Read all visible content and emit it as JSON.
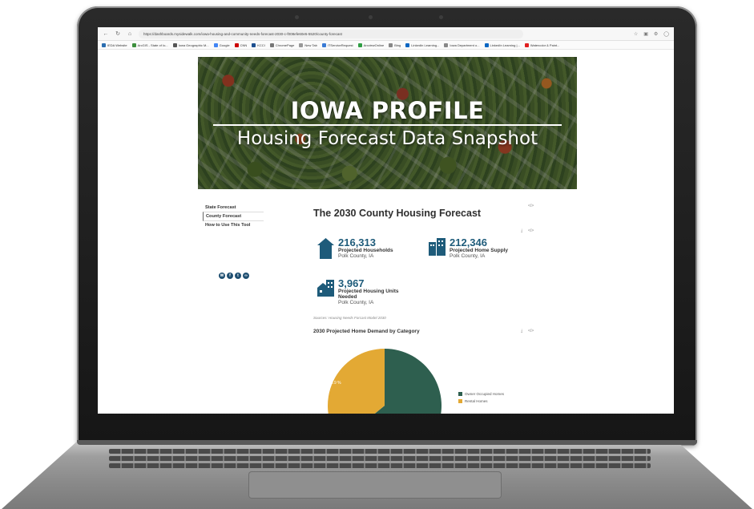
{
  "browser": {
    "url": "https://dashboards.mysidewalk.com/iowa-housing-and-community-needs-forecast-2030-c-f008efe60e5-5520/county-forecast",
    "bookmarks": [
      "IEDA Website",
      "ArcGIS - State of Io...",
      "Iowa Geographic M...",
      "Google",
      "CNN",
      "KCCI",
      "ChromePage",
      "New Tab",
      "ITServiceRequest",
      "ArcviewOnline",
      "Bing",
      "LinkedIn Learning...",
      "Iowa Department o...",
      "LinkedIn Learning |...",
      "Watercolor & Paint..."
    ]
  },
  "hero": {
    "title": "IOWA PROFILE",
    "subtitle": "Housing Forecast Data Snapshot"
  },
  "nav": {
    "items": [
      "State Forecast",
      "County Forecast",
      "How to Use This Tool"
    ],
    "active": "County Forecast"
  },
  "main": {
    "title": "The 2030 County Housing Forecast",
    "embed_label": "</>",
    "stats": [
      {
        "value": "216,313",
        "label": "Projected Households",
        "place": "Polk County, IA",
        "icon": "house-icon"
      },
      {
        "value": "212,346",
        "label": "Projected Home Supply",
        "place": "Polk County, IA",
        "icon": "buildings-icon"
      },
      {
        "value": "3,967",
        "label_line1": "Projected Housing Units",
        "label_line2": "Needed",
        "place": "Polk County, IA",
        "icon": "housing-units-icon"
      }
    ],
    "sources": "Sources: Housing Needs Forcast Model 2030"
  },
  "colors": {
    "stat_number": "#1e5b7a",
    "owner": "#2e5f4f",
    "renter": "#e3a934"
  },
  "chart_data": {
    "type": "pie",
    "title": "2030 Projected Home Demand by Category",
    "categories": [
      "Owner Occupied Homes",
      "Rental Homes"
    ],
    "values": [
      64.1,
      35.9
    ],
    "data_labels": [
      "",
      "35.9 %"
    ],
    "legend": "right"
  }
}
